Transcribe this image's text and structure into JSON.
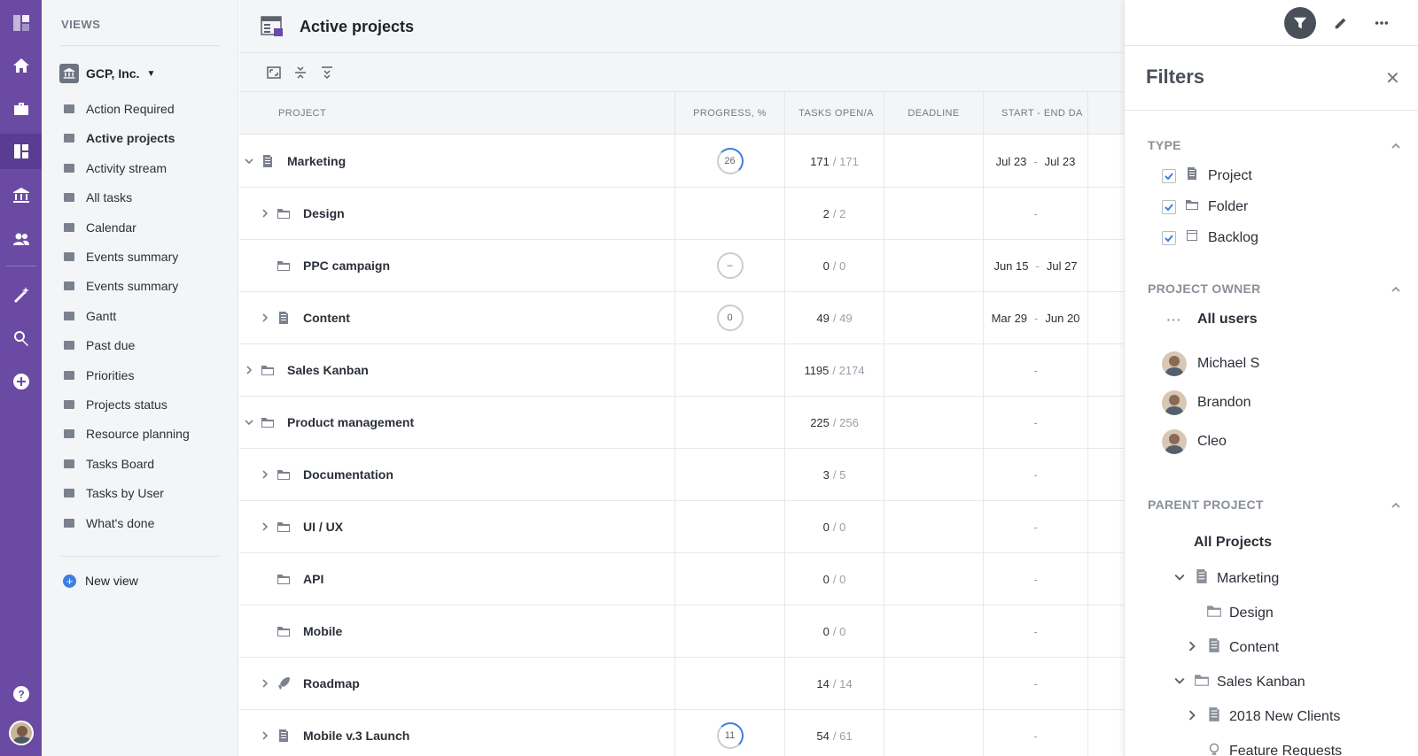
{
  "rail": {
    "items": [
      "logo-icon",
      "home-icon",
      "briefcase-icon",
      "dashboard-icon",
      "bank-icon",
      "users-icon",
      "magic-wand-icon",
      "search-icon",
      "add-icon",
      "help-icon"
    ]
  },
  "views": {
    "header": "VIEWS",
    "org_name": "GCP, Inc.",
    "items": [
      {
        "label": "Action Required",
        "icon": "user-alert-icon"
      },
      {
        "label": "Active projects",
        "icon": "briefcase-icon",
        "active": true
      },
      {
        "label": "Activity stream",
        "icon": "activity-icon"
      },
      {
        "label": "All tasks",
        "icon": "columns-icon"
      },
      {
        "label": "Calendar",
        "icon": "calendar-icon"
      },
      {
        "label": "Events summary",
        "icon": "event-icon"
      },
      {
        "label": "Events summary",
        "icon": "event-icon"
      },
      {
        "label": "Gantt",
        "icon": "gantt-icon"
      },
      {
        "label": "Past due",
        "icon": "past-due-icon"
      },
      {
        "label": "Priorities",
        "icon": "priorities-icon"
      },
      {
        "label": "Projects status",
        "icon": "briefcase-icon"
      },
      {
        "label": "Resource planning",
        "icon": "resource-icon"
      },
      {
        "label": "Tasks Board",
        "icon": "columns-icon"
      },
      {
        "label": "Tasks by User",
        "icon": "user-list-icon"
      },
      {
        "label": "What's done",
        "icon": "check-icon"
      }
    ],
    "new_view": "New view"
  },
  "main": {
    "title": "Active projects",
    "columns": [
      "PROJECT",
      "PROGRESS, %",
      "TASKS OPEN/A",
      "DEADLINE",
      "START - END DA"
    ],
    "rows": [
      {
        "name": "Marketing",
        "type": "project",
        "expanded": true,
        "progress": "26",
        "progress_ring": "partial",
        "open": "171",
        "total": "/ 171",
        "deadline": "",
        "start": "Jul 23",
        "end": "Jul 23"
      },
      {
        "name": "Design",
        "type": "folder",
        "child": true,
        "chevron": true,
        "progress": "",
        "open": "2",
        "total": "/ 2",
        "dash": "-"
      },
      {
        "name": "PPC campaign",
        "type": "folder",
        "child": true,
        "chevron": false,
        "progress": "–",
        "progress_ring": "empty",
        "open": "0",
        "total": "/ 0",
        "start": "Jun 15",
        "end": "Jul 27"
      },
      {
        "name": "Content",
        "type": "project",
        "child": true,
        "chevron": true,
        "progress": "0",
        "progress_ring": "empty",
        "open": "49",
        "total": "/ 49",
        "start": "Mar 29",
        "end": "Jun 20"
      },
      {
        "name": "Sales Kanban",
        "type": "folder",
        "chevron": true,
        "progress": "",
        "open": "1195",
        "total": "/ 2174",
        "dash": "-"
      },
      {
        "name": "Product management",
        "type": "folder",
        "expanded": true,
        "progress": "",
        "open": "225",
        "total": "/ 256",
        "dash": "-"
      },
      {
        "name": "Documentation",
        "type": "folder",
        "child": true,
        "chevron": true,
        "progress": "",
        "open": "3",
        "total": "/ 5",
        "dash": "-"
      },
      {
        "name": "UI / UX",
        "type": "folder",
        "child": true,
        "chevron": true,
        "progress": "",
        "open": "0",
        "total": "/ 0",
        "dash": "-"
      },
      {
        "name": "API",
        "type": "folder",
        "child": true,
        "chevron": false,
        "progress": "",
        "open": "0",
        "total": "/ 0",
        "dash": "-"
      },
      {
        "name": "Mobile",
        "type": "folder",
        "child": true,
        "chevron": false,
        "progress": "",
        "open": "0",
        "total": "/ 0",
        "dash": "-"
      },
      {
        "name": "Roadmap",
        "type": "rocket",
        "child": true,
        "chevron": true,
        "progress": "",
        "open": "14",
        "total": "/ 14",
        "dash": "-"
      },
      {
        "name": "Mobile v.3 Launch",
        "type": "project",
        "child": true,
        "chevron": true,
        "progress": "11",
        "progress_ring": "partial",
        "open": "54",
        "total": "/ 61",
        "dash": "-"
      }
    ]
  },
  "filters": {
    "title": "Filters",
    "close": "✕",
    "type_section": "TYPE",
    "types": [
      "Project",
      "Folder",
      "Backlog"
    ],
    "owner_section": "PROJECT OWNER",
    "all_users": "All users",
    "owners": [
      "Michael S",
      "Brandon",
      "Cleo"
    ],
    "parent_section": "PARENT PROJECT",
    "all_projects": "All Projects",
    "tree": [
      {
        "label": "Marketing",
        "level": 1,
        "chevron": "down",
        "icon": "project"
      },
      {
        "label": "Design",
        "level": 2,
        "chevron": "",
        "icon": "folder"
      },
      {
        "label": "Content",
        "level": 2,
        "chevron": "right",
        "icon": "project"
      },
      {
        "label": "Sales Kanban",
        "level": 1,
        "chevron": "down",
        "icon": "folder"
      },
      {
        "label": "2018 New Clients",
        "level": 2,
        "chevron": "right",
        "icon": "project"
      },
      {
        "label": "Feature Requests",
        "level": 2,
        "chevron": "",
        "icon": "bulb"
      }
    ]
  }
}
